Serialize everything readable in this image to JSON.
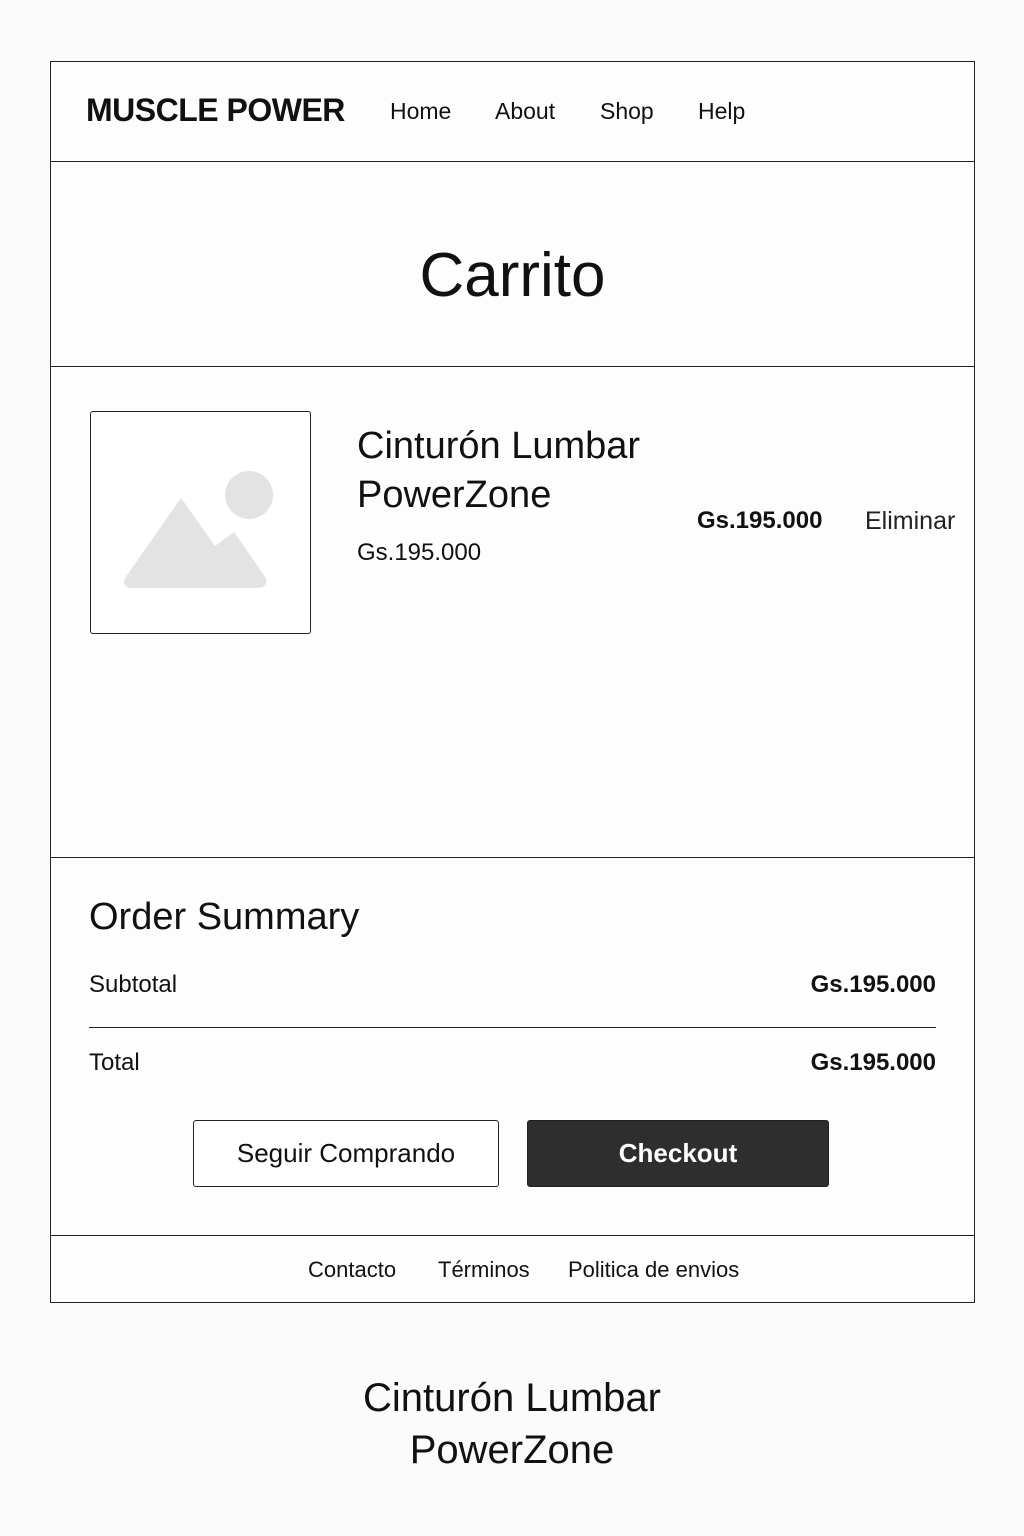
{
  "nav": {
    "logo": "MUSCLE POWER",
    "links": [
      "Home",
      "About",
      "Shop",
      "Help"
    ]
  },
  "page": {
    "title": "Carrito"
  },
  "cart": {
    "items": [
      {
        "name": "Cinturón Lumbar PowerZone",
        "unit_price": "Gs.195.000",
        "line_price": "Gs.195.000",
        "remove_label": "Eliminar",
        "image_icon": "image-placeholder-icon"
      }
    ]
  },
  "summary": {
    "title": "Order Summary",
    "subtotal_label": "Subtotal",
    "subtotal_value": "Gs.195.000",
    "total_label": "Total",
    "total_value": "Gs.195.000",
    "continue_label": "Seguir Comprando",
    "checkout_label": "Checkout"
  },
  "footer": {
    "links": [
      "Contacto",
      "Términos",
      "Politica de envios"
    ]
  },
  "caption": {
    "line1": "Cinturón Lumbar",
    "line2": "PowerZone"
  },
  "colors": {
    "border": "#222222",
    "checkout_bg": "#2e2e2e",
    "placeholder_gray": "#e3e3e3"
  }
}
